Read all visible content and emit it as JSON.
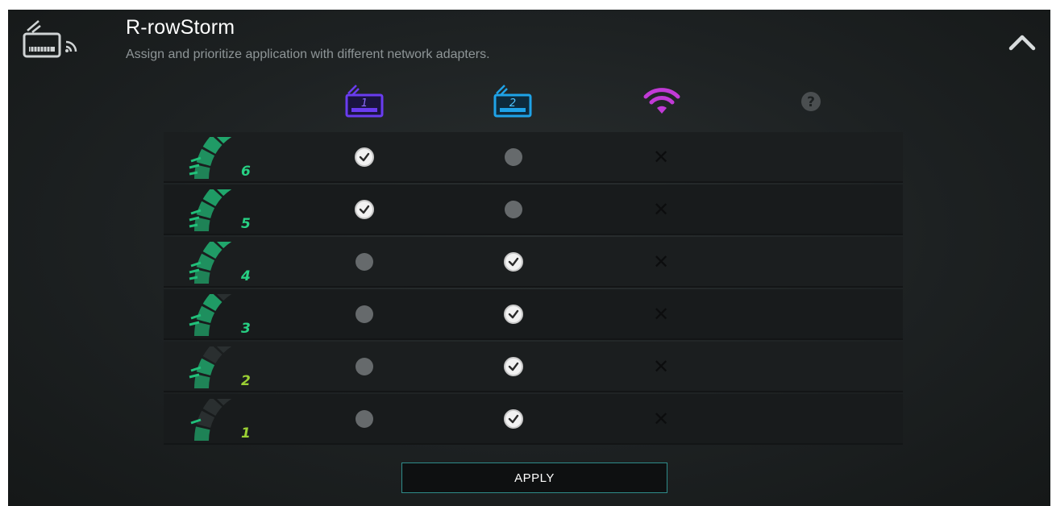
{
  "header": {
    "title": "R-rowStorm",
    "subtitle": "Assign and prioritize application with different network adapters."
  },
  "columns": [
    {
      "icon": "ethernet-adapter-1-icon",
      "label": "1",
      "color": "#6a3cf0"
    },
    {
      "icon": "ethernet-adapter-2-icon",
      "label": "2",
      "color": "#1fa3e8"
    },
    {
      "icon": "wifi-icon",
      "label": "",
      "color": "#c13ad6"
    },
    {
      "icon": "question-icon",
      "label": "?",
      "color": "#555a5c"
    }
  ],
  "rows": [
    {
      "priority": "6",
      "states": [
        "check",
        "dot",
        "x",
        ""
      ]
    },
    {
      "priority": "5",
      "states": [
        "check",
        "dot",
        "x",
        ""
      ]
    },
    {
      "priority": "4",
      "states": [
        "dot",
        "check",
        "x",
        ""
      ]
    },
    {
      "priority": "3",
      "states": [
        "dot",
        "check",
        "x",
        ""
      ]
    },
    {
      "priority": "2",
      "states": [
        "dot",
        "check",
        "x",
        ""
      ]
    },
    {
      "priority": "1",
      "states": [
        "dot",
        "check",
        "x",
        ""
      ]
    }
  ],
  "actions": {
    "apply_label": "APPLY"
  },
  "colors": {
    "accent": "#2f8c8a",
    "gauge": "#21c07a"
  }
}
